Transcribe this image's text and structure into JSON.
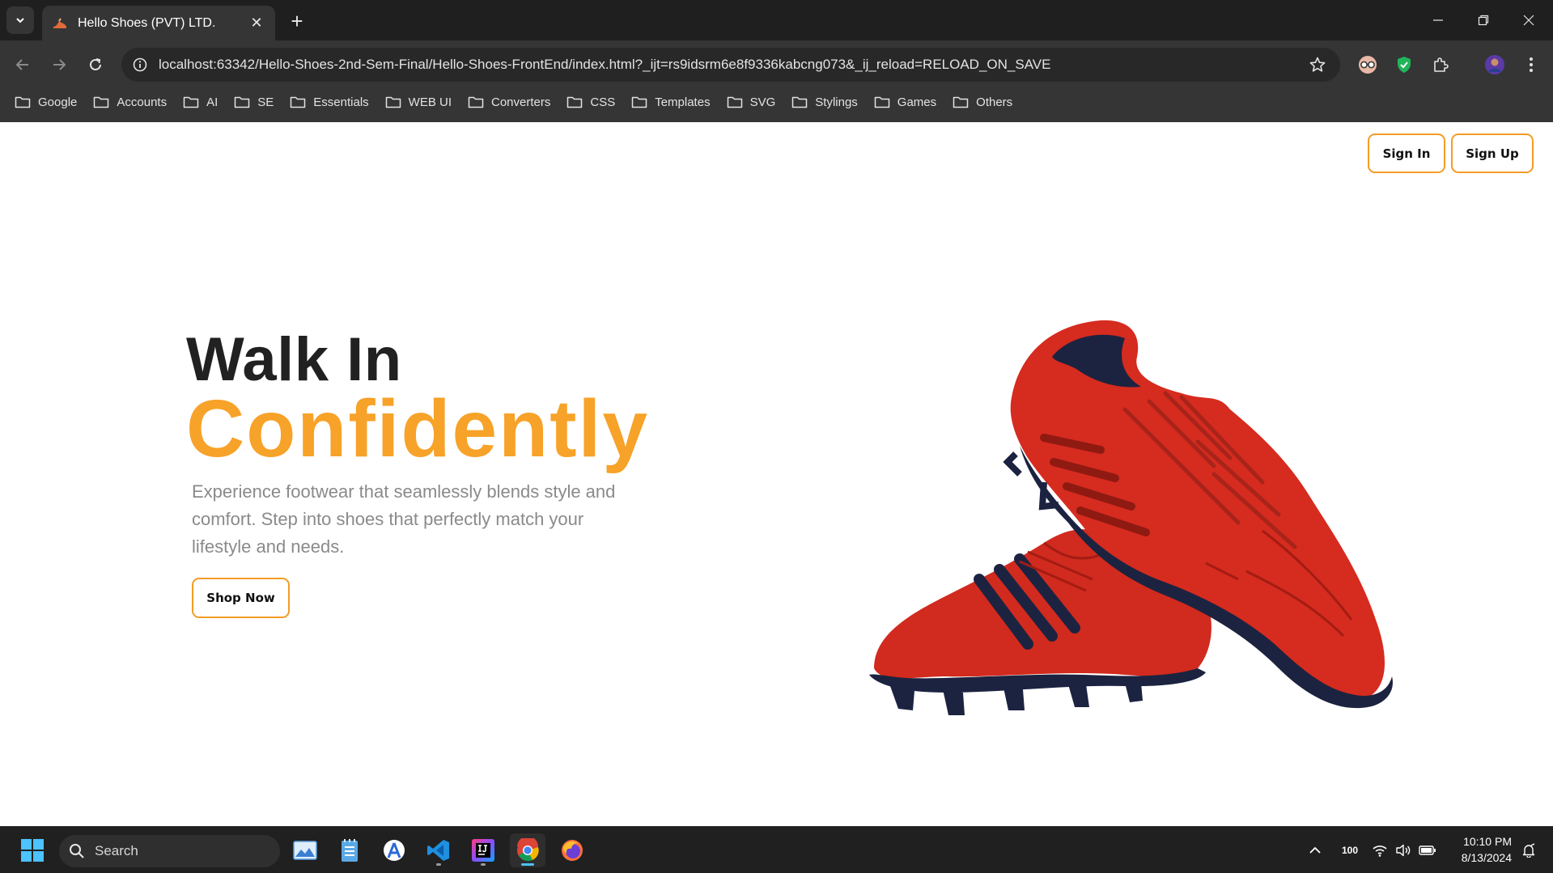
{
  "browser": {
    "tab": {
      "title": "Hello Shoes (PVT) LTD.",
      "close": "✕"
    },
    "new_tab": "+",
    "url": "localhost:63342/Hello-Shoes-2nd-Sem-Final/Hello-Shoes-FrontEnd/index.html?_ijt=rs9idsrm6e8f9336kabcng073&_ij_reload=RELOAD_ON_SAVE",
    "bookmarks": [
      "Google",
      "Accounts",
      "AI",
      "SE",
      "Essentials",
      "WEB UI",
      "Converters",
      "CSS",
      "Templates",
      "SVG",
      "Stylings",
      "Games",
      "Others"
    ]
  },
  "page": {
    "auth": {
      "sign_in": "Sign In",
      "sign_up": "Sign Up"
    },
    "hero": {
      "line1": "Walk In",
      "line2": "Confidently",
      "description": "Experience footwear that seamlessly blends style and comfort. Step into shoes that perfectly match your lifestyle and needs.",
      "cta": "Shop Now"
    }
  },
  "taskbar": {
    "search_placeholder": "Search",
    "battery": "100",
    "time": "10:10 PM",
    "date": "8/13/2024",
    "apps": [
      "photos-app",
      "notepad-app",
      "ai-app",
      "vscode-app",
      "intellij-app",
      "chrome-app",
      "firefox-app"
    ]
  },
  "colors": {
    "accent": "#f7a228",
    "heading": "#212121",
    "muted_text": "#8a8a8a",
    "shoe_red": "#d62b1f",
    "shoe_navy": "#1c2340"
  }
}
